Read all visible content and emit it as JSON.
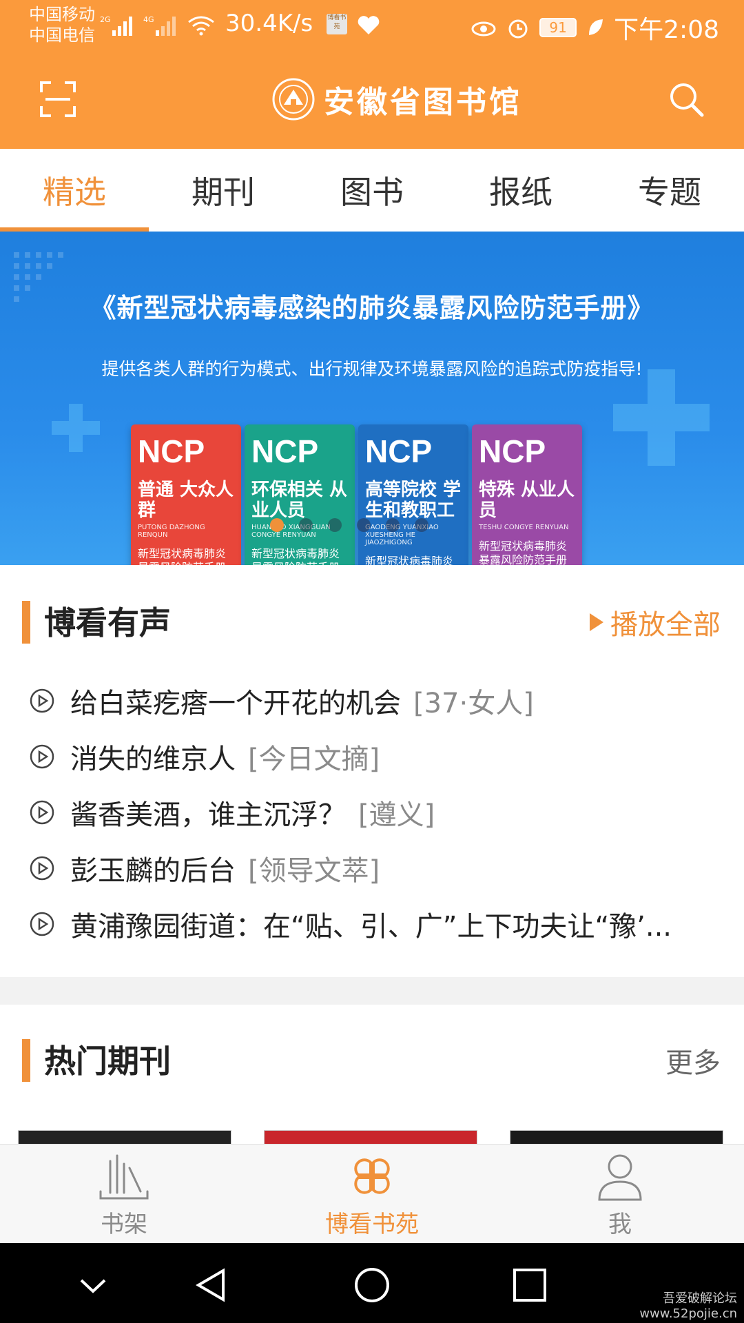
{
  "status_bar": {
    "carrier1": "中国移动",
    "carrier2": "中国电信",
    "net1": "2G",
    "net2": "4G",
    "speed": "30.4K/s",
    "app_badge": "博看书苑",
    "battery": "91",
    "time": "下午2:08"
  },
  "header": {
    "logo_text": "安徽省图书馆"
  },
  "tabs": [
    {
      "label": "精选"
    },
    {
      "label": "期刊"
    },
    {
      "label": "图书"
    },
    {
      "label": "报纸"
    },
    {
      "label": "专题"
    }
  ],
  "banner": {
    "title": "《新型冠状病毒感染的肺炎暴露风险防范手册》",
    "subtitle": "提供各类人群的行为模式、出行规律及环境暴露风险的追踪式防疫指导!",
    "books": [
      {
        "brand": "NCP",
        "title": "普通 大众人群",
        "pinyin": "PUTONG DAZHONG RENQUN",
        "handbook": "新型冠状病毒肺炎 暴露风险防范手册",
        "color": "#e8463a"
      },
      {
        "brand": "NCP",
        "title": "环保相关 从业人员",
        "pinyin": "HUANBAO XIANGGUAN CONGYE RENYUAN",
        "handbook": "新型冠状病毒肺炎 暴露风险防范手册",
        "color": "#1aa38a"
      },
      {
        "brand": "NCP",
        "title": "高等院校 学生和教职工",
        "pinyin": "GAODENG YUANXIAO XUESHENG HE JIAOZHIGONG",
        "handbook": "新型冠状病毒肺炎 暴露风险防范手册",
        "color": "#1f6fc2"
      },
      {
        "brand": "NCP",
        "title": "特殊 从业人员",
        "pinyin": "TESHU CONGYE RENYUAN",
        "handbook": "新型冠状病毒肺炎 暴露风险防范手册",
        "color": "#9a4aa6"
      }
    ]
  },
  "audio_section": {
    "title": "博看有声",
    "play_all": "播放全部",
    "items": [
      {
        "title": "给白菜疙瘩一个开花的机会",
        "source": "[37·女人]"
      },
      {
        "title": "消失的维京人",
        "source": "[今日文摘]"
      },
      {
        "title": "酱香美酒，谁主沉浮？",
        "source": "[遵义]"
      },
      {
        "title": "彭玉麟的后台",
        "source": "[领导文萃]"
      },
      {
        "title": "黄浦豫园街道：在“贴、引、广”上下功夫让“豫’...",
        "source": ""
      }
    ]
  },
  "magazine_section": {
    "title": "热门期刊",
    "more": "更多"
  },
  "bottom_nav": [
    {
      "label": "书架",
      "icon": "bookshelf-icon"
    },
    {
      "label": "博看书苑",
      "icon": "clover-icon"
    },
    {
      "label": "我",
      "icon": "person-icon"
    }
  ],
  "watermark": {
    "line1": "吾爱破解论坛",
    "line2": "www.52pojie.cn"
  },
  "colors": {
    "accent": "#f0913a",
    "header": "#fb9a3c",
    "banner": "#2a8cea"
  }
}
